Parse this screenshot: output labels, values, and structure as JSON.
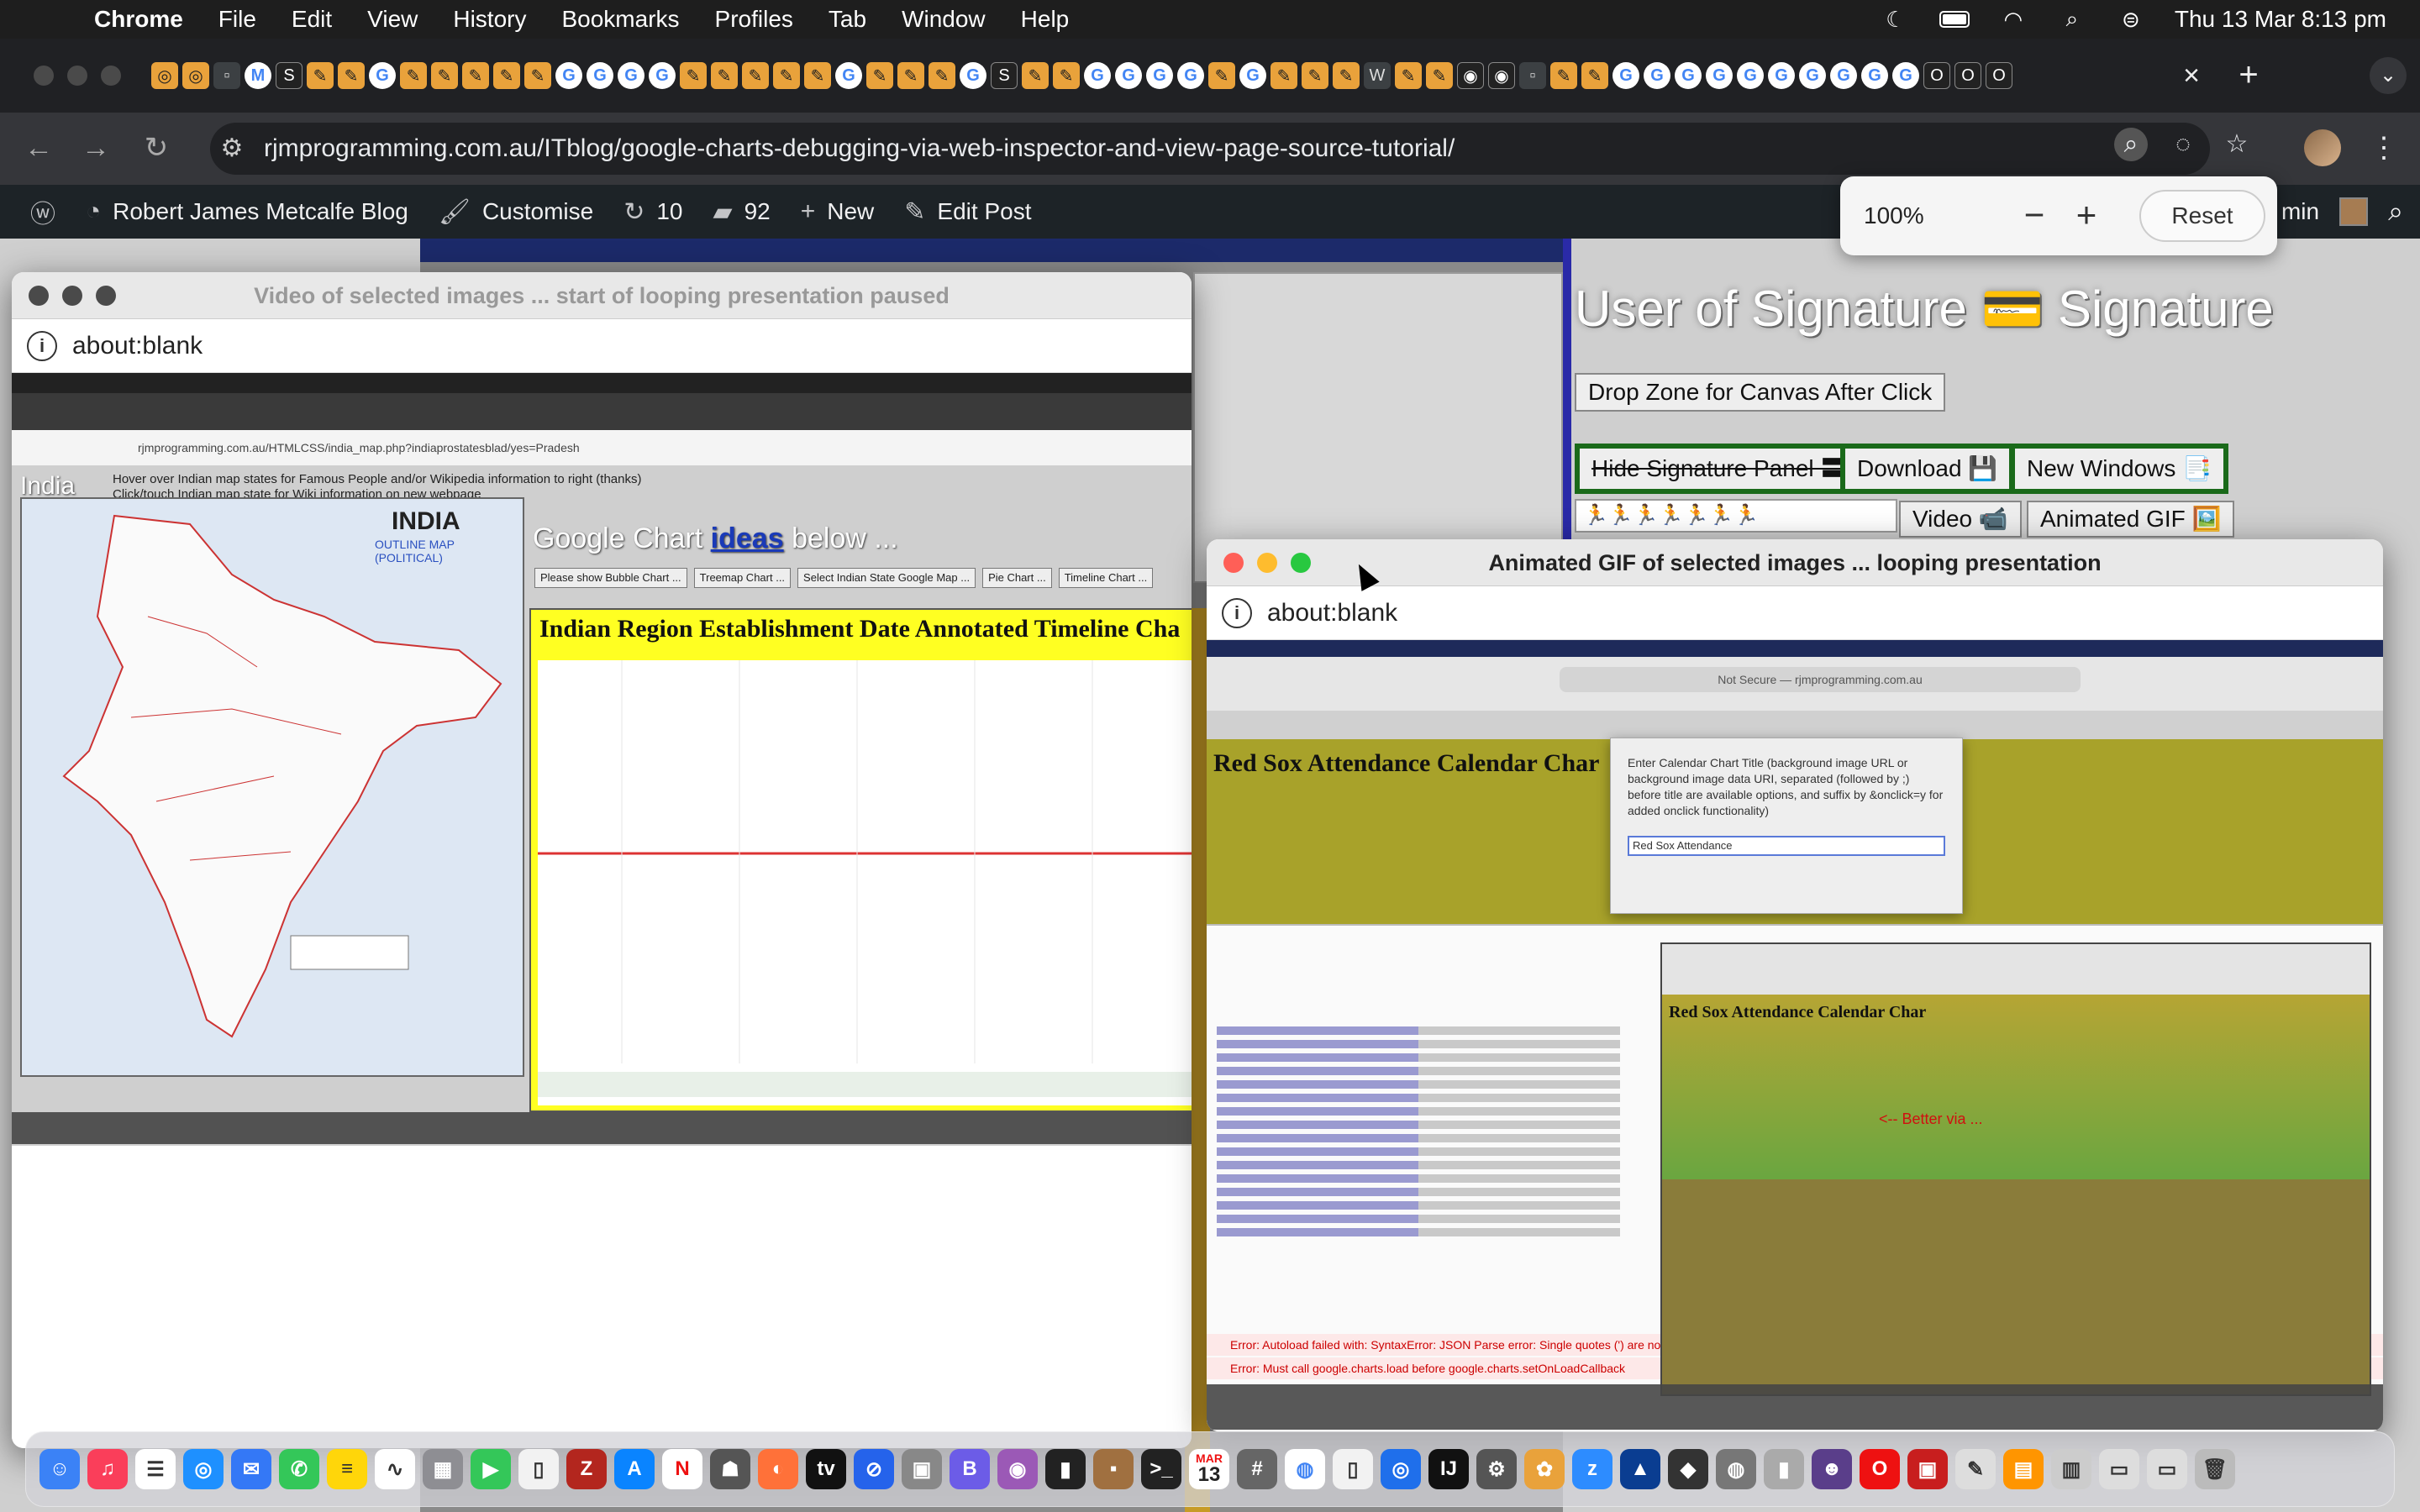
{
  "menubar": {
    "app": "Chrome",
    "items": [
      "File",
      "Edit",
      "View",
      "History",
      "Bookmarks",
      "Profiles",
      "Tab",
      "Window",
      "Help"
    ],
    "clock": "Thu 13 Mar  8:13 pm"
  },
  "browser": {
    "url": "rjmprogramming.com.au/ITblog/google-charts-debugging-via-web-inspector-and-view-page-source-tutorial/",
    "zoom": {
      "percent": "100%",
      "minus": "−",
      "plus": "+",
      "reset": "Reset"
    }
  },
  "wp_admin": {
    "site": "Robert James Metcalfe Blog",
    "customise": "Customise",
    "updates": "10",
    "comments": "92",
    "new": "New",
    "edit_post": "Edit Post",
    "user_fragment": "min"
  },
  "signature_page": {
    "title": "User of Signature 💳 Signature",
    "drop_zone": "Drop Zone for Canvas After Click",
    "hide_panel": "Hide Signature Panel 〓",
    "download": "Download 💾",
    "new_windows": "New Windows 📑",
    "runners": "🏃🏃🏃🏃🏃🏃🏃",
    "video": "Video 📹",
    "animated_gif": "Animated GIF 🖼️"
  },
  "video_window": {
    "title": "Video of selected images ... start of looping presentation paused",
    "url": "about:blank",
    "shot": {
      "address": "rjmprogramming.com.au/HTMLCSS/india_map.php?indiaprostatesblad/yes=Pradesh",
      "india_word": "India",
      "notes": [
        "Hover over Indian map states for Famous People and/or Wikipedia information to right (thanks)",
        "Click/touch Indian map state for Wiki information on new webpage"
      ],
      "map_label": "INDIA",
      "map_sub": "OUTLINE MAP (POLITICAL)",
      "chart_header_pre": "Google Chart ",
      "chart_header_link": "ideas",
      "chart_header_post": " below ...",
      "buttons": [
        "Please show Bubble Chart ...",
        "Treemap Chart ...",
        "Select Indian State Google Map ...",
        "Pie Chart ...",
        "Timeline Chart ..."
      ],
      "timeline_title": "Indian Region Establishment Date Annotated Timeline Cha"
    }
  },
  "gif_window": {
    "title": "Animated GIF of selected images ... looping presentation",
    "url": "about:blank",
    "shot": {
      "safari_url": "Not Secure — rjmprogramming.com.au",
      "page_title": "Red Sox Attendance Calendar Char",
      "dialog_text": "Enter Calendar Chart Title (background image URL or background image data URI, separated (followed by ;) before title are available options, and suffix by &onclick=y for added onclick functionality)",
      "dialog_input": "Red Sox Attendance",
      "nested_title": "Red Sox Attendance Calendar Char",
      "better_via": "<-- Better via ...",
      "error1": "Error: Autoload failed with: SyntaxError: JSON Parse error: Single quotes (') are not allowed",
      "error2": "Error: Must call google.charts.load before google.charts.setOnLoadCallback"
    }
  },
  "dock": {
    "calendar_month": "MAR",
    "calendar_day": "13"
  }
}
